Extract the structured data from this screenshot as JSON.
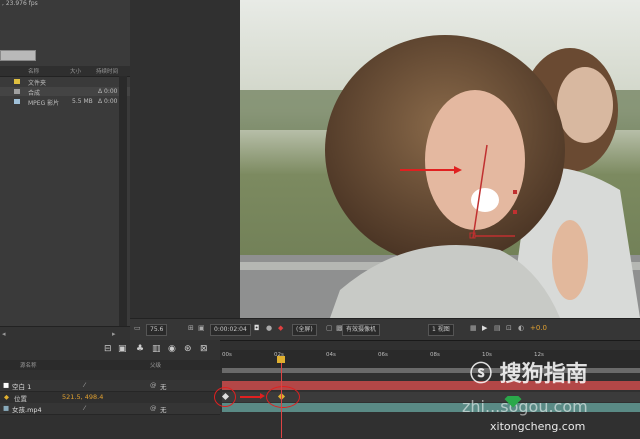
{
  "project": {
    "info": ", 23.976 fps",
    "columns": {
      "name": "名称",
      "size": "大小",
      "duration": "持续时间"
    },
    "items": [
      {
        "name": "文件夹",
        "size": "",
        "duration": "",
        "color": "#e0c040"
      },
      {
        "name": "合成",
        "size": "",
        "duration": "Δ 0:00",
        "color": "#a0a0a0"
      },
      {
        "name": "MPEG 影片",
        "size": "5.5 MB",
        "duration": "Δ 0:00",
        "color": "#a0c0d8"
      }
    ]
  },
  "viewer": {
    "zoom": "75.6",
    "timecode": "0:00:02:04",
    "resolution": "(全屏)",
    "camera": "有效摄像机",
    "views": "1 视图",
    "exposure": "+0.0"
  },
  "timeline": {
    "layer_header": "源名称",
    "parent_header": "父级",
    "layers": [
      {
        "num": "1",
        "name": "空白 1",
        "parent": "无"
      },
      {
        "name": "位置",
        "value": "521.5, 498.4",
        "is_property": true
      },
      {
        "num": "2",
        "name": "女孩.mp4",
        "parent": "无"
      }
    ],
    "ruler": [
      "00s",
      "02s",
      "04s",
      "06s",
      "08s",
      "10s",
      "12s"
    ],
    "current_time_fraction": 0.15,
    "accent": "#e0b030"
  },
  "watermark": {
    "logo": "ⓢ 搜狗指南",
    "mid": "zhi...sogou.com",
    "site": "xitongcheng.com"
  }
}
